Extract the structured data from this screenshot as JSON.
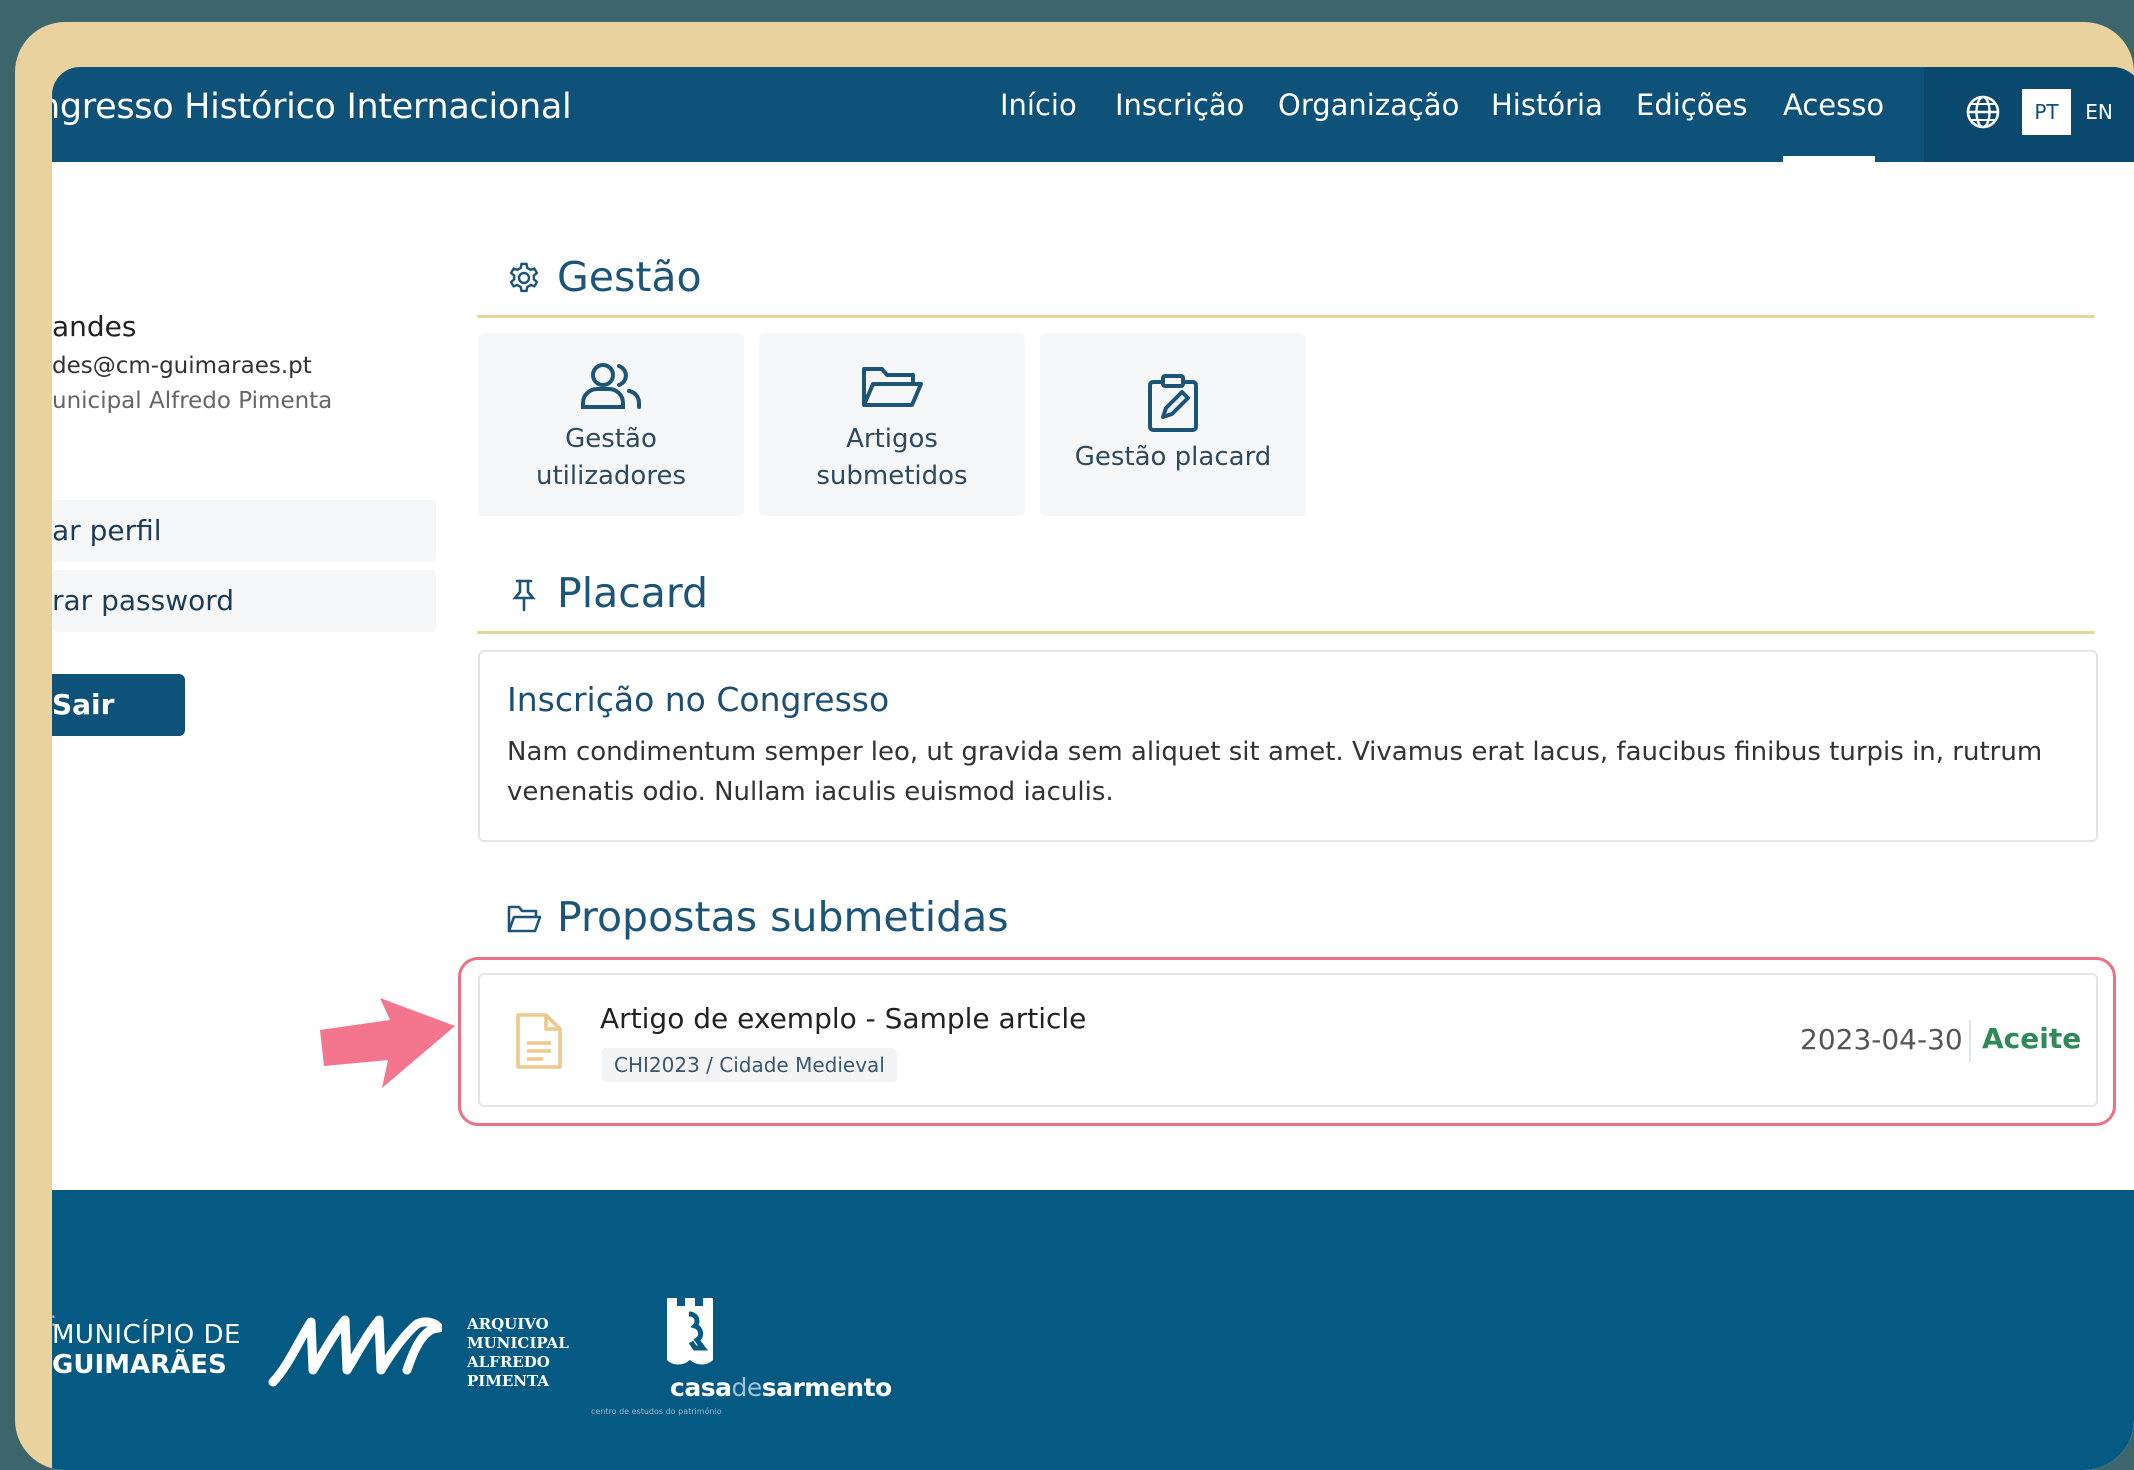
{
  "header": {
    "site_title": "ngresso Histórico Internacional",
    "nav": [
      "Início",
      "Inscrição",
      "Organização",
      "História",
      "Edições",
      "Acesso"
    ],
    "active_nav": "Acesso",
    "lang_pt": "PT",
    "lang_en": "EN"
  },
  "sidebar": {
    "name": "andes",
    "email": "des@cm-guimaraes.pt",
    "org": "unicipal Alfredo Pimenta",
    "edit_profile": "ar perfil",
    "change_password": "rar password",
    "logout": "Sair"
  },
  "gestao": {
    "title": "Gestão",
    "tiles": [
      {
        "line1": "Gestão",
        "line2": "utilizadores"
      },
      {
        "line1": "Artigos",
        "line2": "submetidos"
      },
      {
        "line1": "Gestão placard",
        "line2": ""
      }
    ]
  },
  "placard": {
    "title": "Placard",
    "card_title": "Inscrição no Congresso",
    "card_body": "Nam condimentum semper leo, ut gravida sem aliquet sit amet. Vivamus erat lacus, faucibus finibus turpis in, rutrum venenatis odio. Nullam iaculis euismod iaculis."
  },
  "propostas": {
    "title": "Propostas submetidas",
    "items": [
      {
        "title": "Artigo de exemplo - Sample article",
        "tag": "CHI2023 / Cidade Medieval",
        "date": "2023-04-30",
        "status": "Aceite"
      }
    ]
  },
  "footer": {
    "small": ":",
    "municipio_line1": "MUNICÍPIO DE",
    "municipio_line2": "GUIMARÃES",
    "arquivo": [
      "ARQUIVO",
      "MUNICIPAL",
      "ALFREDO",
      "PIMENTA"
    ],
    "casa_a": "casa",
    "casa_b": "de",
    "casa_c": "sarmento",
    "casa_sub": "centro de estudos do património"
  },
  "colors": {
    "brand_blue": "#0e5179",
    "accent_gold": "#ead49d",
    "highlight_pink": "#ef6f85",
    "accepted_green": "#2f8a57"
  }
}
